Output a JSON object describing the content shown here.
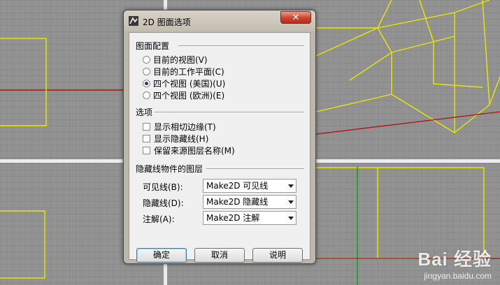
{
  "dialog": {
    "title": "2D 图面选项",
    "close_symbol": "✕",
    "layout_group": {
      "title": "图面配置",
      "options": [
        "目前的视图(V)",
        "目前的工作平面(C)",
        "四个视图 (美国)(U)",
        "四个视图 (欧洲)(E)"
      ],
      "selected": "四个视图 (美国)(U)"
    },
    "options_group": {
      "title": "选项",
      "checkboxes": [
        "显示相切边缘(T)",
        "显示隐藏线(H)",
        "保留来源图层名称(M)"
      ]
    },
    "layers_group": {
      "title": "隐藏线物件的图层",
      "rows": [
        {
          "label": "可见线(B):",
          "value": "Make2D 可见线"
        },
        {
          "label": "隐藏线(D):",
          "value": "Make2D 隐藏线"
        },
        {
          "label": "注解(A):",
          "value": "Make2D 注解"
        }
      ]
    },
    "buttons": {
      "ok": "确定",
      "cancel": "取消",
      "help": "说明"
    }
  },
  "watermark": {
    "logo": "Bai 经验",
    "url": "jingyan.baidu.com"
  },
  "colors": {
    "viewport_bg": "#8f8f8f",
    "wireframe": "#e8e800",
    "axis_red": "#b01010",
    "axis_green": "#18a018"
  }
}
